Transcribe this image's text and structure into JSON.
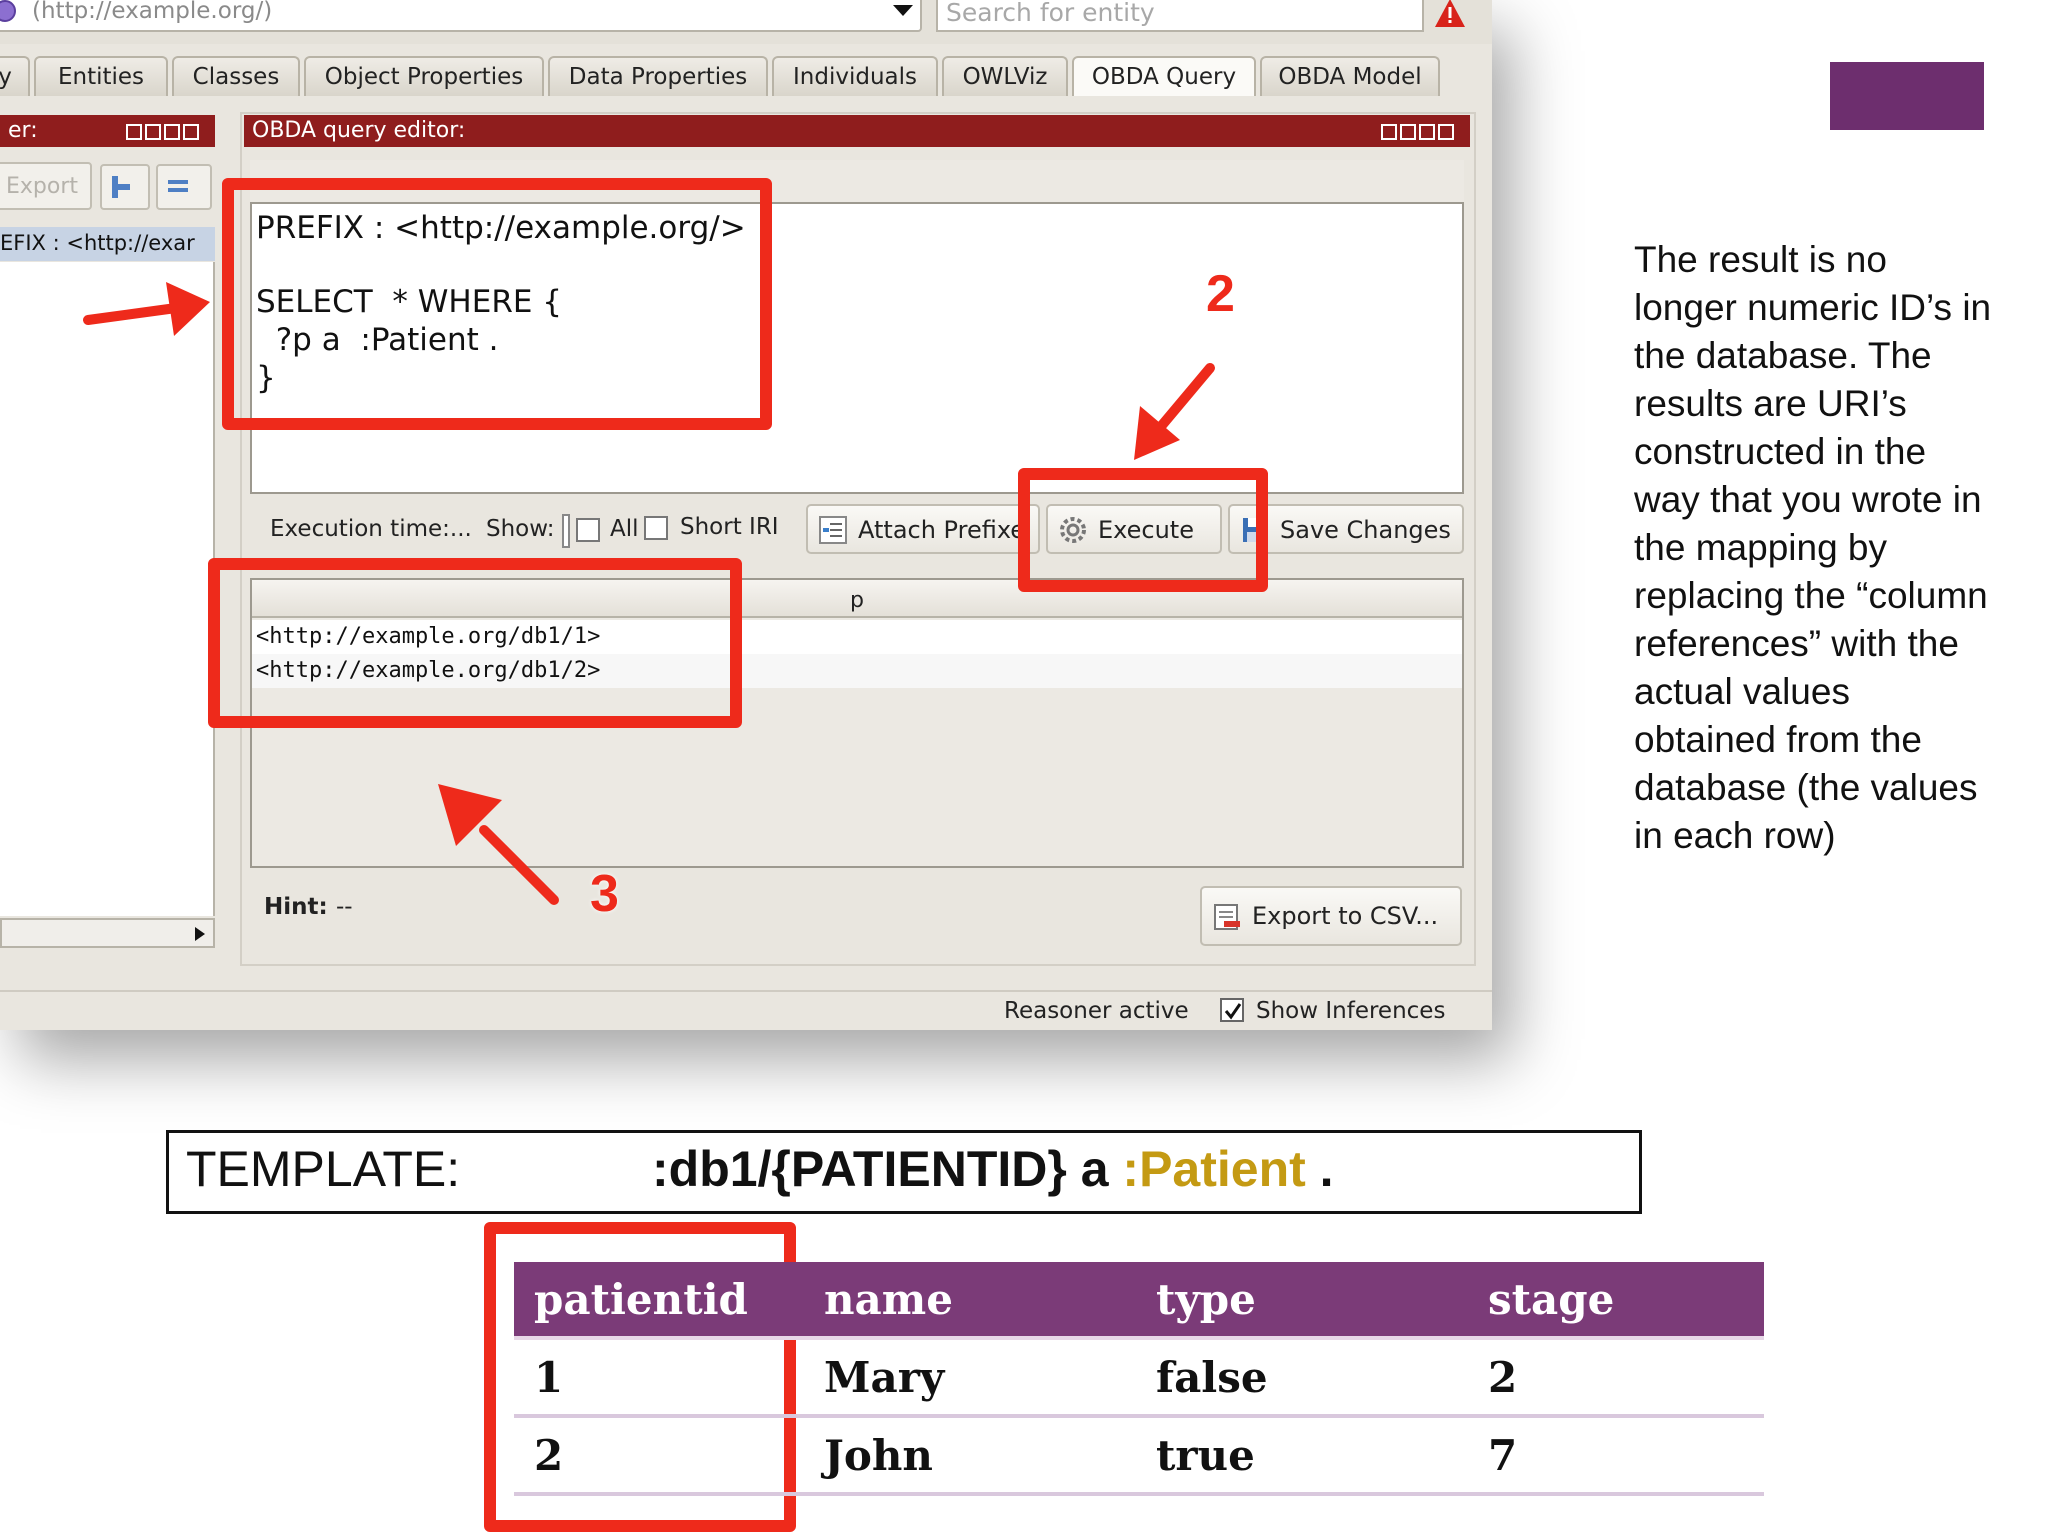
{
  "toolbar": {
    "uri_value": "(http://example.org/)",
    "search_placeholder": "Search for entity"
  },
  "tabs": [
    {
      "label": "y"
    },
    {
      "label": "Entities"
    },
    {
      "label": "Classes"
    },
    {
      "label": "Object Properties"
    },
    {
      "label": "Data Properties"
    },
    {
      "label": "Individuals"
    },
    {
      "label": "OWLViz"
    },
    {
      "label": "OBDA Query"
    },
    {
      "label": "OBDA Model"
    }
  ],
  "left_panel": {
    "title": "er:",
    "export_label": "Export",
    "prefix_row": "EFIX : <http://exar"
  },
  "editor": {
    "title": "OBDA query editor:",
    "lines": [
      "PREFIX : <http://example.org/>",
      "",
      "SELECT  * WHERE {",
      "  ?p a  :Patient .",
      "}"
    ]
  },
  "exec_bar": {
    "exec_time": "Execution time:...",
    "show": "Show:",
    "all": "All",
    "short_iri": "Short IRI",
    "attach_prefix": "Attach Prefixe",
    "execute": "Execute",
    "save_changes": "Save Changes"
  },
  "results": {
    "column": "p",
    "rows": [
      "<http://example.org/db1/1>",
      "<http://example.org/db1/2>"
    ]
  },
  "bottom": {
    "hint_label": "Hint:",
    "hint_value": "--",
    "export_csv": "Export to CSV...",
    "reasoner": "Reasoner active",
    "show_inferences": "Show Inferences"
  },
  "annotations": {
    "n2": "2",
    "n3": "3"
  },
  "slide": {
    "description": "The result is no longer numeric ID’s in the database. The results are URI’s constructed in the way that you wrote in the mapping by replacing the “column references” with the actual values obtained from the database (the values in each row)",
    "template_label": "TEMPLATE:",
    "template_prefix": ":db1/{PATIENTID} a ",
    "template_class": ":Patient",
    "template_suffix": " ."
  },
  "db_table": {
    "headers": [
      "patientid",
      "name",
      "type",
      "stage"
    ],
    "rows": [
      [
        "1",
        "Mary",
        "false",
        "2"
      ],
      [
        "2",
        "John",
        "true",
        "7"
      ]
    ]
  },
  "colors": {
    "panel_header": "#8f1d1d",
    "highlight_red": "#ee2a1b",
    "table_header": "#7b3b78",
    "template_class": "#c49a13"
  }
}
